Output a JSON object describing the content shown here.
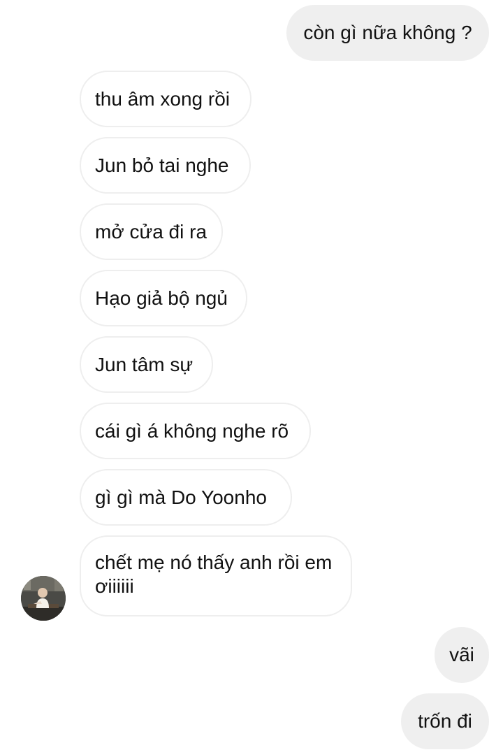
{
  "conversation": {
    "messages": [
      {
        "direction": "outgoing",
        "text": "còn gì nữa không ?"
      },
      {
        "direction": "incoming",
        "text": "thu âm xong rồi"
      },
      {
        "direction": "incoming",
        "text": "Jun bỏ tai nghe"
      },
      {
        "direction": "incoming",
        "text": "mở cửa đi ra"
      },
      {
        "direction": "incoming",
        "text": "Hạo giả bộ ngủ"
      },
      {
        "direction": "incoming",
        "text": "Jun tâm sự"
      },
      {
        "direction": "incoming",
        "text": "cái gì á không nghe rõ"
      },
      {
        "direction": "incoming",
        "text": "gì gì mà Do Yoonho"
      },
      {
        "direction": "incoming",
        "text": "chết mẹ nó thấy anh rồi em ơiiiiii"
      },
      {
        "direction": "outgoing",
        "text": "vãi"
      },
      {
        "direction": "outgoing",
        "text": "trốn đi"
      }
    ]
  },
  "avatar": {
    "icon": "contact-avatar-photo"
  },
  "colors": {
    "background": "#ffffff",
    "outgoing_bubble": "#efefef",
    "incoming_border": "#eeeeee",
    "text": "#111111"
  }
}
